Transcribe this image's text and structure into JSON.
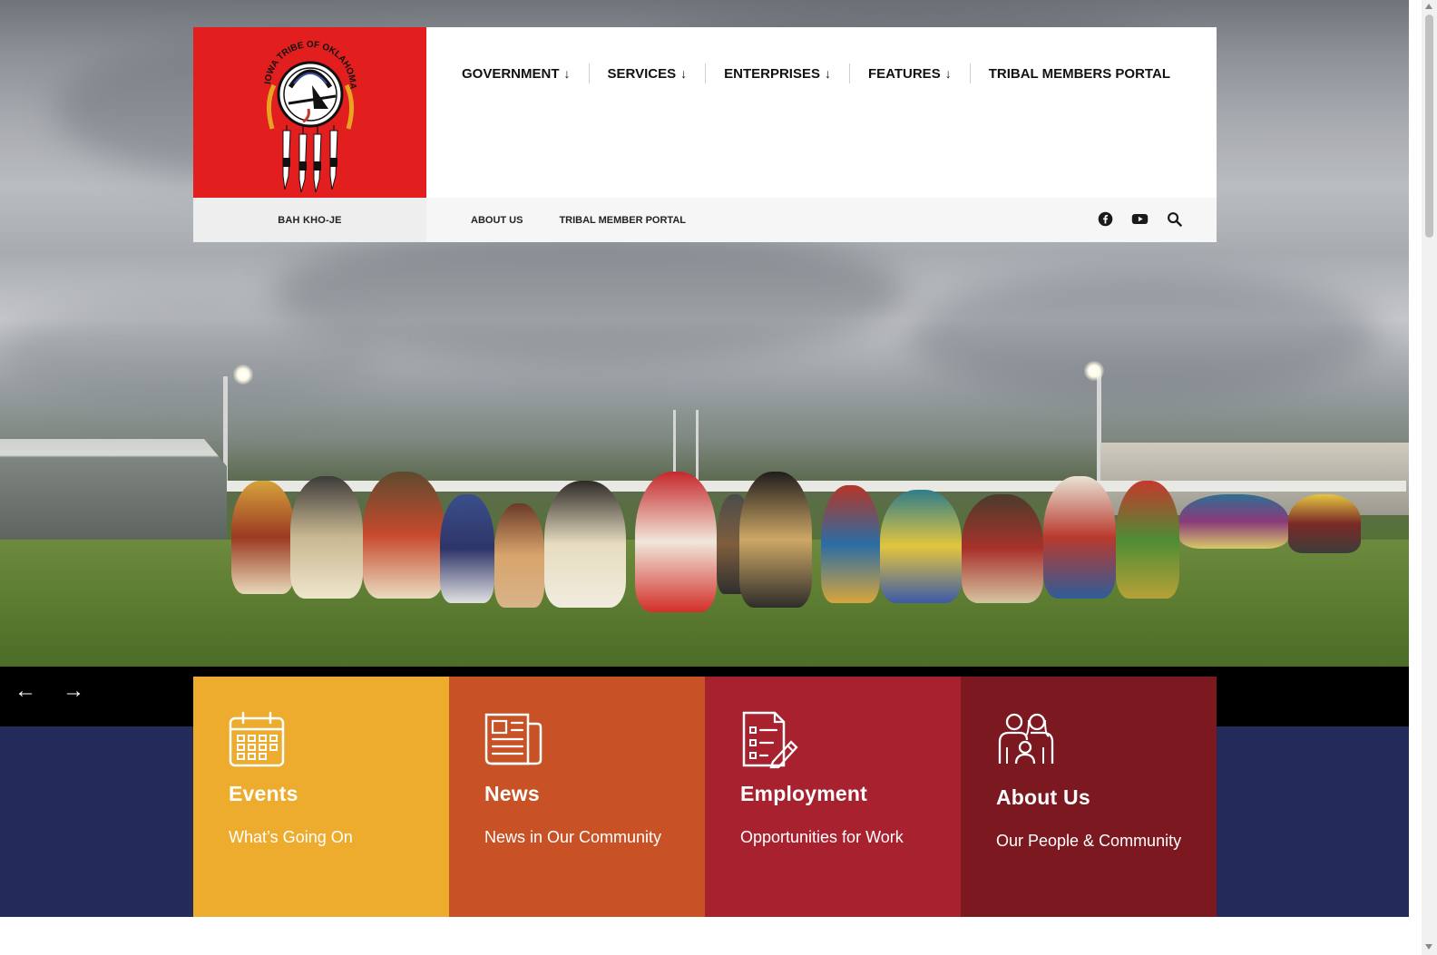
{
  "site": {
    "seal_text": "IOWA TRIBE OF OKLAHOMA",
    "tagline": "BAH KHO-JE"
  },
  "main_nav": [
    {
      "label": "GOVERNMENT",
      "has_dropdown": true
    },
    {
      "label": "SERVICES",
      "has_dropdown": true
    },
    {
      "label": "ENTERPRISES",
      "has_dropdown": true
    },
    {
      "label": "FEATURES",
      "has_dropdown": true
    },
    {
      "label": "TRIBAL MEMBERS PORTAL",
      "has_dropdown": false
    }
  ],
  "dropdown_arrow": "↓",
  "utility_nav": [
    {
      "label": "ABOUT US"
    },
    {
      "label": "TRIBAL MEMBER PORTAL"
    }
  ],
  "utility_icons": [
    "facebook-icon",
    "youtube-icon",
    "search-icon"
  ],
  "slider": {
    "prev": "←",
    "next": "→"
  },
  "cards": [
    {
      "title": "Events",
      "subtitle": "What’s Going On",
      "icon": "calendar-icon",
      "color": "#edac2d"
    },
    {
      "title": "News",
      "subtitle": "News in Our Community",
      "icon": "newspaper-icon",
      "color": "#c85226"
    },
    {
      "title": "Employment",
      "subtitle": "Opportunities for Work",
      "icon": "checklist-icon",
      "color": "#a8212f"
    },
    {
      "title": "About Us",
      "subtitle": "Our People & Community",
      "icon": "people-icon",
      "color": "#7c1820"
    }
  ],
  "colors": {
    "logo_red": "#e31e1e",
    "navy": "#222b5a"
  }
}
